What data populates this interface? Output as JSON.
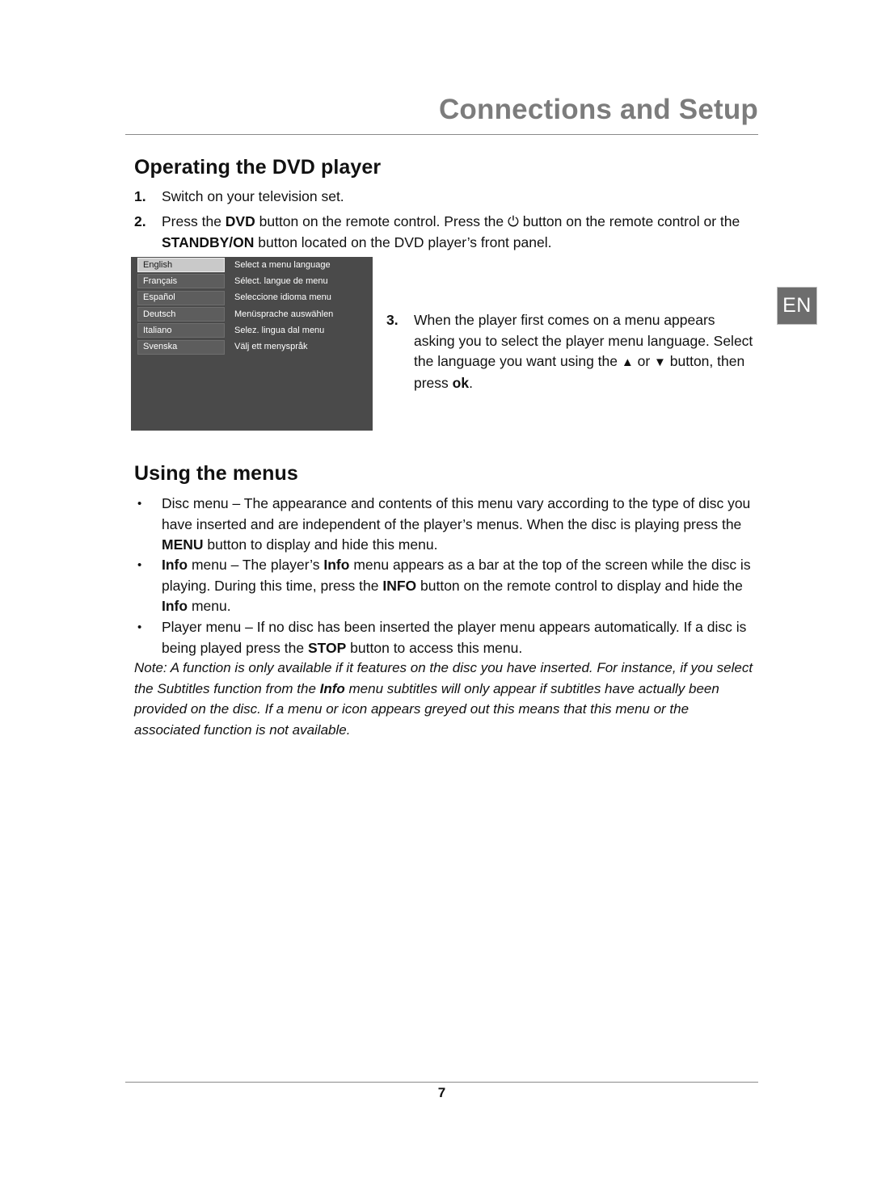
{
  "header": {
    "chapter_title": "Connections and Setup"
  },
  "language_tab": {
    "label": "EN"
  },
  "headings": {
    "operating": "Operating the DVD player",
    "using_menus": "Using the menus"
  },
  "steps": [
    {
      "number": "1.",
      "text": "Switch on your television set."
    },
    {
      "number": "2.",
      "text_before_dvd": "Press the ",
      "bold_dvd": "DVD",
      "text_after_dvd": " button on the remote control. Press the ",
      "power_icon": "⏻",
      "text_after_power": " button on the remote control or the ",
      "bold_standby": "STANDBY/ON",
      "text_end": " button located on the DVD player’s front panel."
    },
    {
      "number": "3.",
      "text_start": "When the player first comes on a menu appears asking you to select the player menu language. Select the language you want using the ",
      "up_arrow": "▲",
      "text_middle": " or ",
      "down_arrow": "▼",
      "text_after_arrows": " button, then press ",
      "bold_ok": "ok",
      "text_end": "."
    }
  ],
  "tv_menu": {
    "rows": [
      {
        "language": "English",
        "prompt": "Select a menu language",
        "selected": true
      },
      {
        "language": "Français",
        "prompt": "Sélect. langue de menu",
        "selected": false
      },
      {
        "language": "Español",
        "prompt": "Seleccione idioma menu",
        "selected": false
      },
      {
        "language": "Deutsch",
        "prompt": "Menüsprache auswählen",
        "selected": false
      },
      {
        "language": "Italiano",
        "prompt": "Selez. lingua dal menu",
        "selected": false
      },
      {
        "language": "Svenska",
        "prompt": "Välj ett menyspråk",
        "selected": false
      }
    ],
    "colors": {
      "background": "#4a4a4a",
      "button": "#5d5d5d",
      "button_selected": "#c9c9c9"
    }
  },
  "bullets": [
    {
      "marker": "•",
      "text_start": "Disc menu – The appearance and contents of this menu vary according to the type of disc you have inserted and are independent of the player’s menus. When the disc is playing press the ",
      "bold": "MENU",
      "text_end": " button to display and hide this menu."
    },
    {
      "marker": "•",
      "bold_lead": "Info",
      "text_a": " menu – The player’s ",
      "bold_b": "Info",
      "text_b": " menu appears as a bar at the top of the screen while the disc is playing. During this time, press the ",
      "bold_c": "INFO",
      "text_c": " button on the remote control to display and hide the ",
      "bold_d": "Info",
      "text_d": " menu."
    },
    {
      "marker": "•",
      "text_start": "Player menu – If no disc has been inserted the player menu appears automatically. If a disc is being played press the ",
      "bold": "STOP",
      "text_end": " button to access this menu."
    }
  ],
  "note": {
    "text_start": "Note: A function is only available if it features on the disc you have inserted. For instance, if you select the Subtitles function from the ",
    "bold": "Info",
    "text_end": " menu subtitles will only appear if subtitles have actually been provided on the disc. If a menu or icon appears greyed out this means that this menu or the associated function is not available."
  },
  "footer": {
    "page_number": "7"
  }
}
